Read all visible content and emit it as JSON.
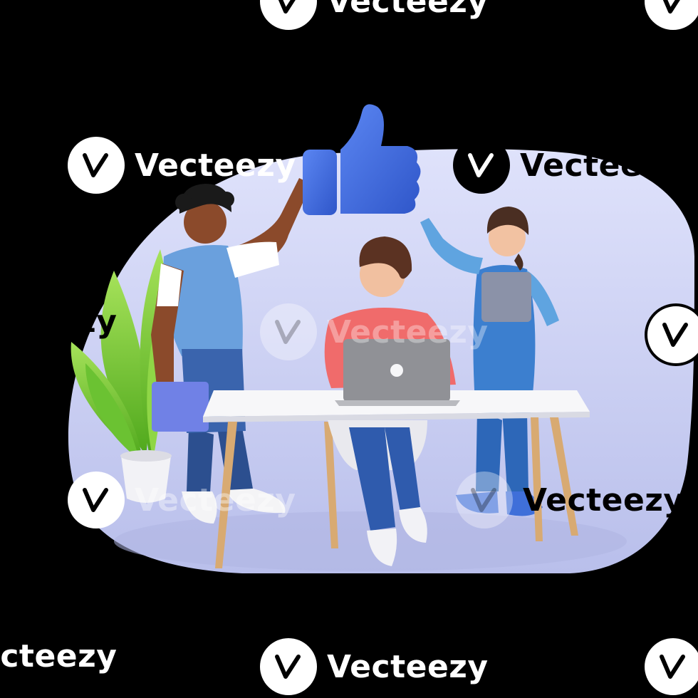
{
  "watermark": {
    "text": "Vecteezy",
    "partial_text": "ecteezy",
    "icon": "vecteezy-logo-icon"
  },
  "scene": {
    "background_color": "#000000",
    "blob_color": "#C9CEF0",
    "thumbs_up_color": "#3F6BDF",
    "plant_color": "#7BCB2E",
    "laptop_color": "#8F9094",
    "desk_color": "#F5F5F7",
    "icons": [
      "thumbs-up-icon",
      "laptop-icon",
      "tablet-icon",
      "plant-icon"
    ]
  }
}
